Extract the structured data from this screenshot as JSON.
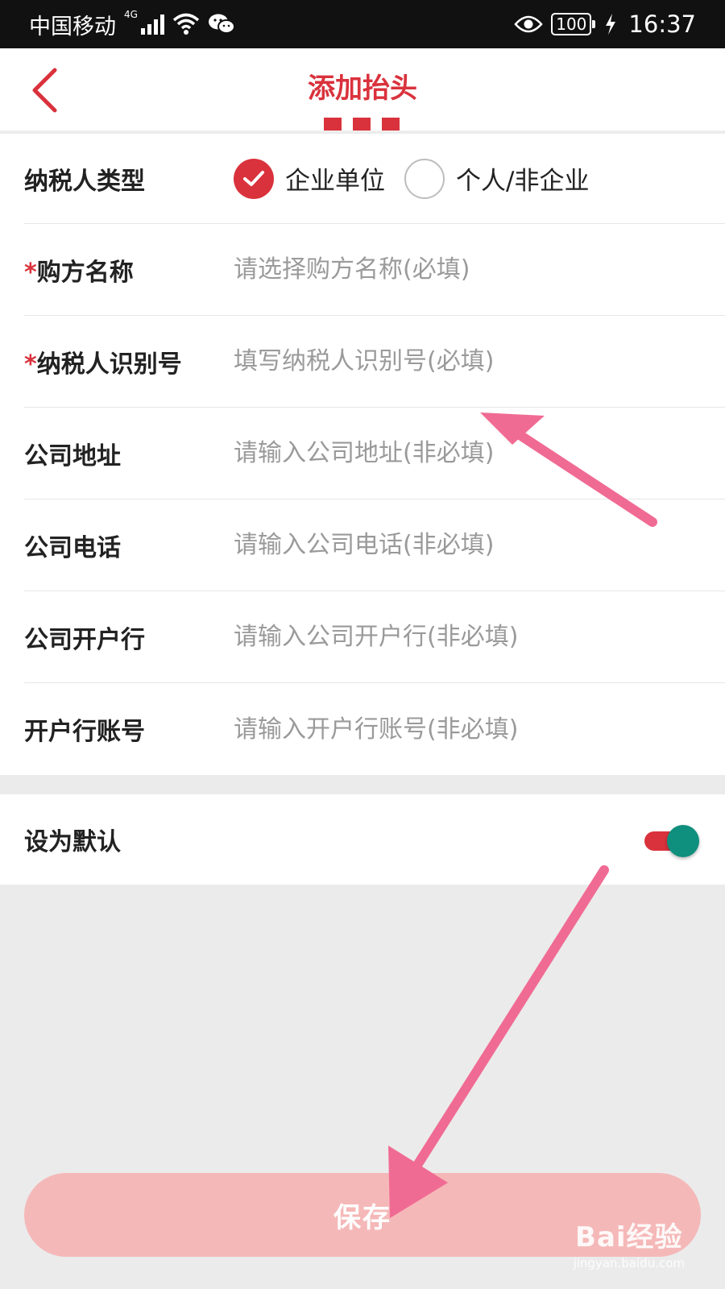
{
  "status_bar": {
    "carrier": "中国移动",
    "network": "4G",
    "battery": "100",
    "time": "16:37"
  },
  "header": {
    "title": "添加抬头"
  },
  "form": {
    "taxpayer_type": {
      "label": "纳税人类型",
      "options": [
        "企业单位",
        "个人/非企业"
      ],
      "selected": "企业单位"
    },
    "buyer_name": {
      "required_mark": "*",
      "label": "购方名称",
      "placeholder": "请选择购方名称(必填)"
    },
    "taxpayer_id": {
      "required_mark": "*",
      "label": "纳税人识别号",
      "placeholder": "填写纳税人识别号(必填)"
    },
    "company_address": {
      "label": "公司地址",
      "placeholder": "请输入公司地址(非必填)"
    },
    "company_phone": {
      "label": "公司电话",
      "placeholder": "请输入公司电话(非必填)"
    },
    "company_bank": {
      "label": "公司开户行",
      "placeholder": "请输入公司开户行(非必填)"
    },
    "bank_account": {
      "label": "开户行账号",
      "placeholder": "请输入开户行账号(非必填)"
    }
  },
  "default_setting": {
    "label": "设为默认",
    "enabled": true
  },
  "save_button": {
    "label": "保存"
  },
  "watermark": {
    "logo": "Bai经验",
    "url": "jingyan.baidu.com"
  },
  "colors": {
    "accent": "#d9323c",
    "toggle_knob": "#0f8f7d",
    "save_button": "#f5b8b8",
    "annotation_arrow": "#f06b93"
  }
}
